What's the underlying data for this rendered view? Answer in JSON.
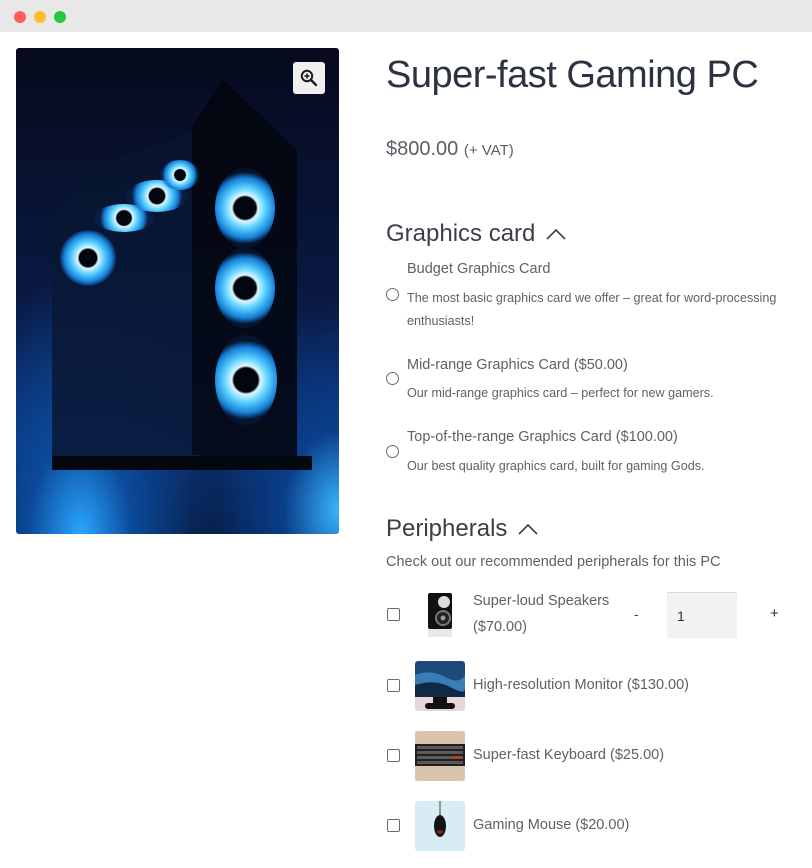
{
  "window": {
    "controls": [
      "close",
      "minimize",
      "maximize"
    ]
  },
  "gallery": {
    "image_alt": "Gaming PC tower with blue fans",
    "zoom_icon": "magnifier-plus-icon"
  },
  "product": {
    "title": "Super-fast Gaming PC",
    "price": "$800.00",
    "price_suffix": "(+ VAT)"
  },
  "graphics": {
    "heading": "Graphics card",
    "toggle_icon": "chevron-up-icon",
    "options": [
      {
        "name": "Budget Graphics Card",
        "description": "The most basic graphics card we offer – great for word-processing enthusiasts!",
        "selected": false
      },
      {
        "name": "Mid-range Graphics Card ($50.00)",
        "description": "Our mid-range graphics card – perfect for new gamers.",
        "selected": false
      },
      {
        "name": "Top-of-the-range Graphics Card ($100.00)",
        "description": "Our best quality graphics card, built for gaming Gods.",
        "selected": false
      }
    ]
  },
  "peripherals": {
    "heading": "Peripherals",
    "toggle_icon": "chevron-up-icon",
    "intro": "Check out our recommended peripherals for this PC",
    "items": [
      {
        "name_line1": "Super-loud Speakers",
        "name_line2": "($70.00)",
        "checked": false,
        "thumb": "speaker"
      },
      {
        "name": "High-resolution Monitor ($130.00)",
        "checked": false,
        "thumb": "monitor"
      },
      {
        "name": "Super-fast Keyboard ($25.00)",
        "checked": false,
        "thumb": "keyboard"
      },
      {
        "name": "Gaming Mouse ($20.00)",
        "checked": false,
        "thumb": "mouse"
      }
    ],
    "quantity": {
      "minus": "-",
      "value": "1",
      "plus": "+"
    }
  },
  "colors": {
    "heading": "#3a3f48",
    "body_text": "#5d6168",
    "quantity_bg": "#f2f2f2"
  }
}
